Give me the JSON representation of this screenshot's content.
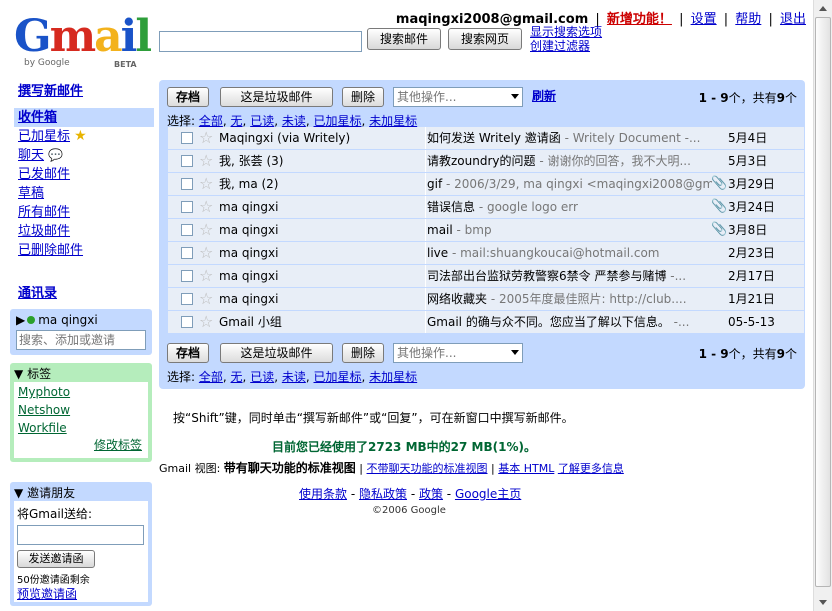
{
  "logo": {
    "text_parts": [
      "G",
      "m",
      "a",
      "i",
      "l"
    ],
    "colors": [
      "#1a53c8",
      "#d62a1f",
      "#f3b21c",
      "#1a53c8",
      "#2e9e3a"
    ],
    "by": "by Google",
    "beta": "BETA"
  },
  "top": {
    "email": "maqingxi2008@gmail.com",
    "new_features": "新增功能！",
    "settings": "设置",
    "help": "帮助",
    "logout": "退出"
  },
  "search": {
    "query": "",
    "search_mail": "搜索邮件",
    "search_web": "搜索网页",
    "show_options": "显示搜索选项",
    "create_filter": "创建过滤器"
  },
  "nav": {
    "compose": "撰写新邮件",
    "items": [
      {
        "label": "收件箱",
        "active": true
      },
      {
        "label": "已加星标"
      },
      {
        "label": "聊天"
      },
      {
        "label": "已发邮件"
      },
      {
        "label": "草稿"
      },
      {
        "label": "所有邮件"
      },
      {
        "label": "垃圾邮件"
      },
      {
        "label": "已删除邮件"
      }
    ],
    "contacts": "通讯录"
  },
  "chat": {
    "me": "ma qingxi",
    "placeholder": "搜索、添加或邀请"
  },
  "labels": {
    "header": "标签",
    "items": [
      "Myphoto",
      "Netshow",
      "Workfile"
    ],
    "edit": "修改标签"
  },
  "invite": {
    "header": "邀请朋友",
    "prompt": "将Gmail送给:",
    "send": "发送邀请函",
    "left": "50份邀请函剩余",
    "preview": "预览邀请函"
  },
  "toolbar": {
    "archive": "存档",
    "spam": "这是垃圾邮件",
    "delete": "删除",
    "more": "其他操作...",
    "refresh": "刷新",
    "count_range": "1 - 9",
    "count_mid": "个，共有",
    "count_total": "9",
    "count_end": "个",
    "select_label": "选择:",
    "select_all": "全部",
    "select_none": "无",
    "select_read": "已读",
    "select_unread": "未读",
    "select_starred": "已加星标",
    "select_unstarred": "未加星标"
  },
  "emails": [
    {
      "from": "Maqingxi (via Writely)",
      "subject": "如何发送  Writely 邀请函",
      "snippet": " - Writely Document -...",
      "attach": false,
      "date": "5月4日"
    },
    {
      "from": "我, 张荟  (3)",
      "subject": "请教zoundry的问题",
      "snippet": " - 谢谢你的回答，我不大明...",
      "attach": false,
      "date": "5月3日"
    },
    {
      "from": "我, ma (2)",
      "subject": "gif",
      "snippet": " - 2006/3/29, ma qingxi <maqingxi2008@gm...",
      "attach": true,
      "date": "3月29日"
    },
    {
      "from": "ma qingxi",
      "subject": "错误信息",
      "snippet": " - google logo err",
      "attach": true,
      "date": "3月24日"
    },
    {
      "from": "ma qingxi",
      "subject": "mail",
      "snippet": " - bmp",
      "attach": true,
      "date": "3月8日"
    },
    {
      "from": "ma qingxi",
      "subject": "live",
      "snippet": " - mail:shuangkoucai@hotmail.com",
      "attach": false,
      "date": "2月23日"
    },
    {
      "from": "ma qingxi",
      "subject": "司法部出台监狱劳教警察6禁令  严禁参与赌博",
      "snippet": " -...",
      "attach": false,
      "date": "2月17日"
    },
    {
      "from": "ma qingxi",
      "subject": "网络收藏夹",
      "snippet": " - 2005年度最佳照片:   http://club....",
      "attach": false,
      "date": "1月21日"
    },
    {
      "from": "Gmail 小组",
      "subject": "Gmail 的确与众不同。您应当了解以下信息。",
      "snippet": " -...",
      "attach": false,
      "date": "05-5-13"
    }
  ],
  "footer": {
    "hint": "按“Shift”键，同时单击“撰写新邮件”或“回复”，可在新窗口中撰写新邮件。",
    "usage": "目前您已经使用了2723 MB中的27 MB(1%)。",
    "views_label": "Gmail 视图:",
    "view_current": "带有聊天功能的标准视图",
    "view_nochat": "不带聊天功能的标准视图",
    "view_basic": "基本 HTML",
    "learn_more": "了解更多信息",
    "terms": "使用条款",
    "privacy": "隐私政策",
    "policy": "政策",
    "google_home": "Google主页",
    "copyright": "©2006 Google"
  }
}
